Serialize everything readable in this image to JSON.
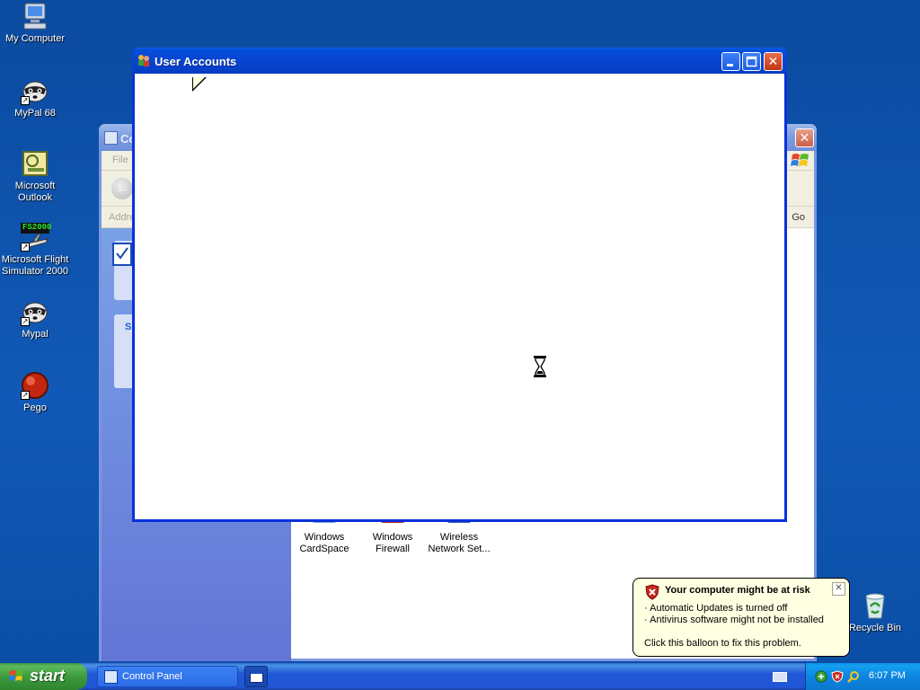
{
  "desktop": {
    "icons": [
      {
        "label": "My Computer",
        "icon": "my-computer-icon"
      },
      {
        "label": "MyPal 68",
        "icon": "raccoon-icon"
      },
      {
        "label": "Microsoft Outlook",
        "icon": "outlook-icon"
      },
      {
        "label": "Microsoft Flight Simulator 2000",
        "icon": "flight-simulator-icon",
        "badge": "FS2000"
      },
      {
        "label": "Mypal",
        "icon": "raccoon-icon"
      },
      {
        "label": "Pego",
        "icon": "red-sphere-icon"
      },
      {
        "label": "Recycle Bin",
        "icon": "recycle-bin-icon"
      }
    ]
  },
  "control_panel": {
    "title": "Co",
    "menu_file": "File",
    "address_label": "Addre",
    "go_label": "Go",
    "task_header": "S",
    "applets": [
      {
        "label_line1": "Windows",
        "label_line2": "CardSpace"
      },
      {
        "label_line1": "Windows",
        "label_line2": "Firewall"
      },
      {
        "label_line1": "Wireless",
        "label_line2": "Network Set..."
      }
    ]
  },
  "user_accounts": {
    "title": "User Accounts",
    "close_glyph": "✕",
    "cursor": "hourglass-icon"
  },
  "taskbar": {
    "start_label": "start",
    "control_panel_label": "Control Panel",
    "clock": "6:07 PM"
  },
  "balloon": {
    "title": "Your computer might be at risk",
    "line1": "· Automatic Updates is turned off",
    "line2": "· Antivirus software might not be installed",
    "line3": "Click this balloon to fix this problem.",
    "close_glyph": "✕"
  },
  "colors": {
    "desktop": "#0a4da3",
    "taskbar": "#2157d7",
    "start": "#3d9a3d",
    "balloon": "#ffffe1",
    "title_active": "#0846d2"
  }
}
